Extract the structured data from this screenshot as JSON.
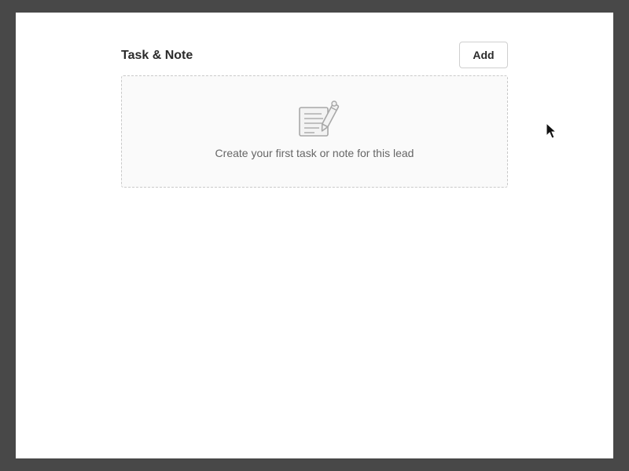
{
  "section": {
    "title": "Task & Note",
    "add_button_label": "Add",
    "empty_state": {
      "icon": "note-pencil-icon",
      "message": "Create your first task or note for this lead"
    }
  },
  "colors": {
    "outer_background": "#484848",
    "page_background": "#ffffff",
    "title_text": "#2b2b2b",
    "muted_text": "#666666",
    "dashed_border": "#c9c9c9",
    "empty_fill": "#fafafa"
  },
  "cursor": {
    "icon": "mouse-pointer-icon"
  }
}
